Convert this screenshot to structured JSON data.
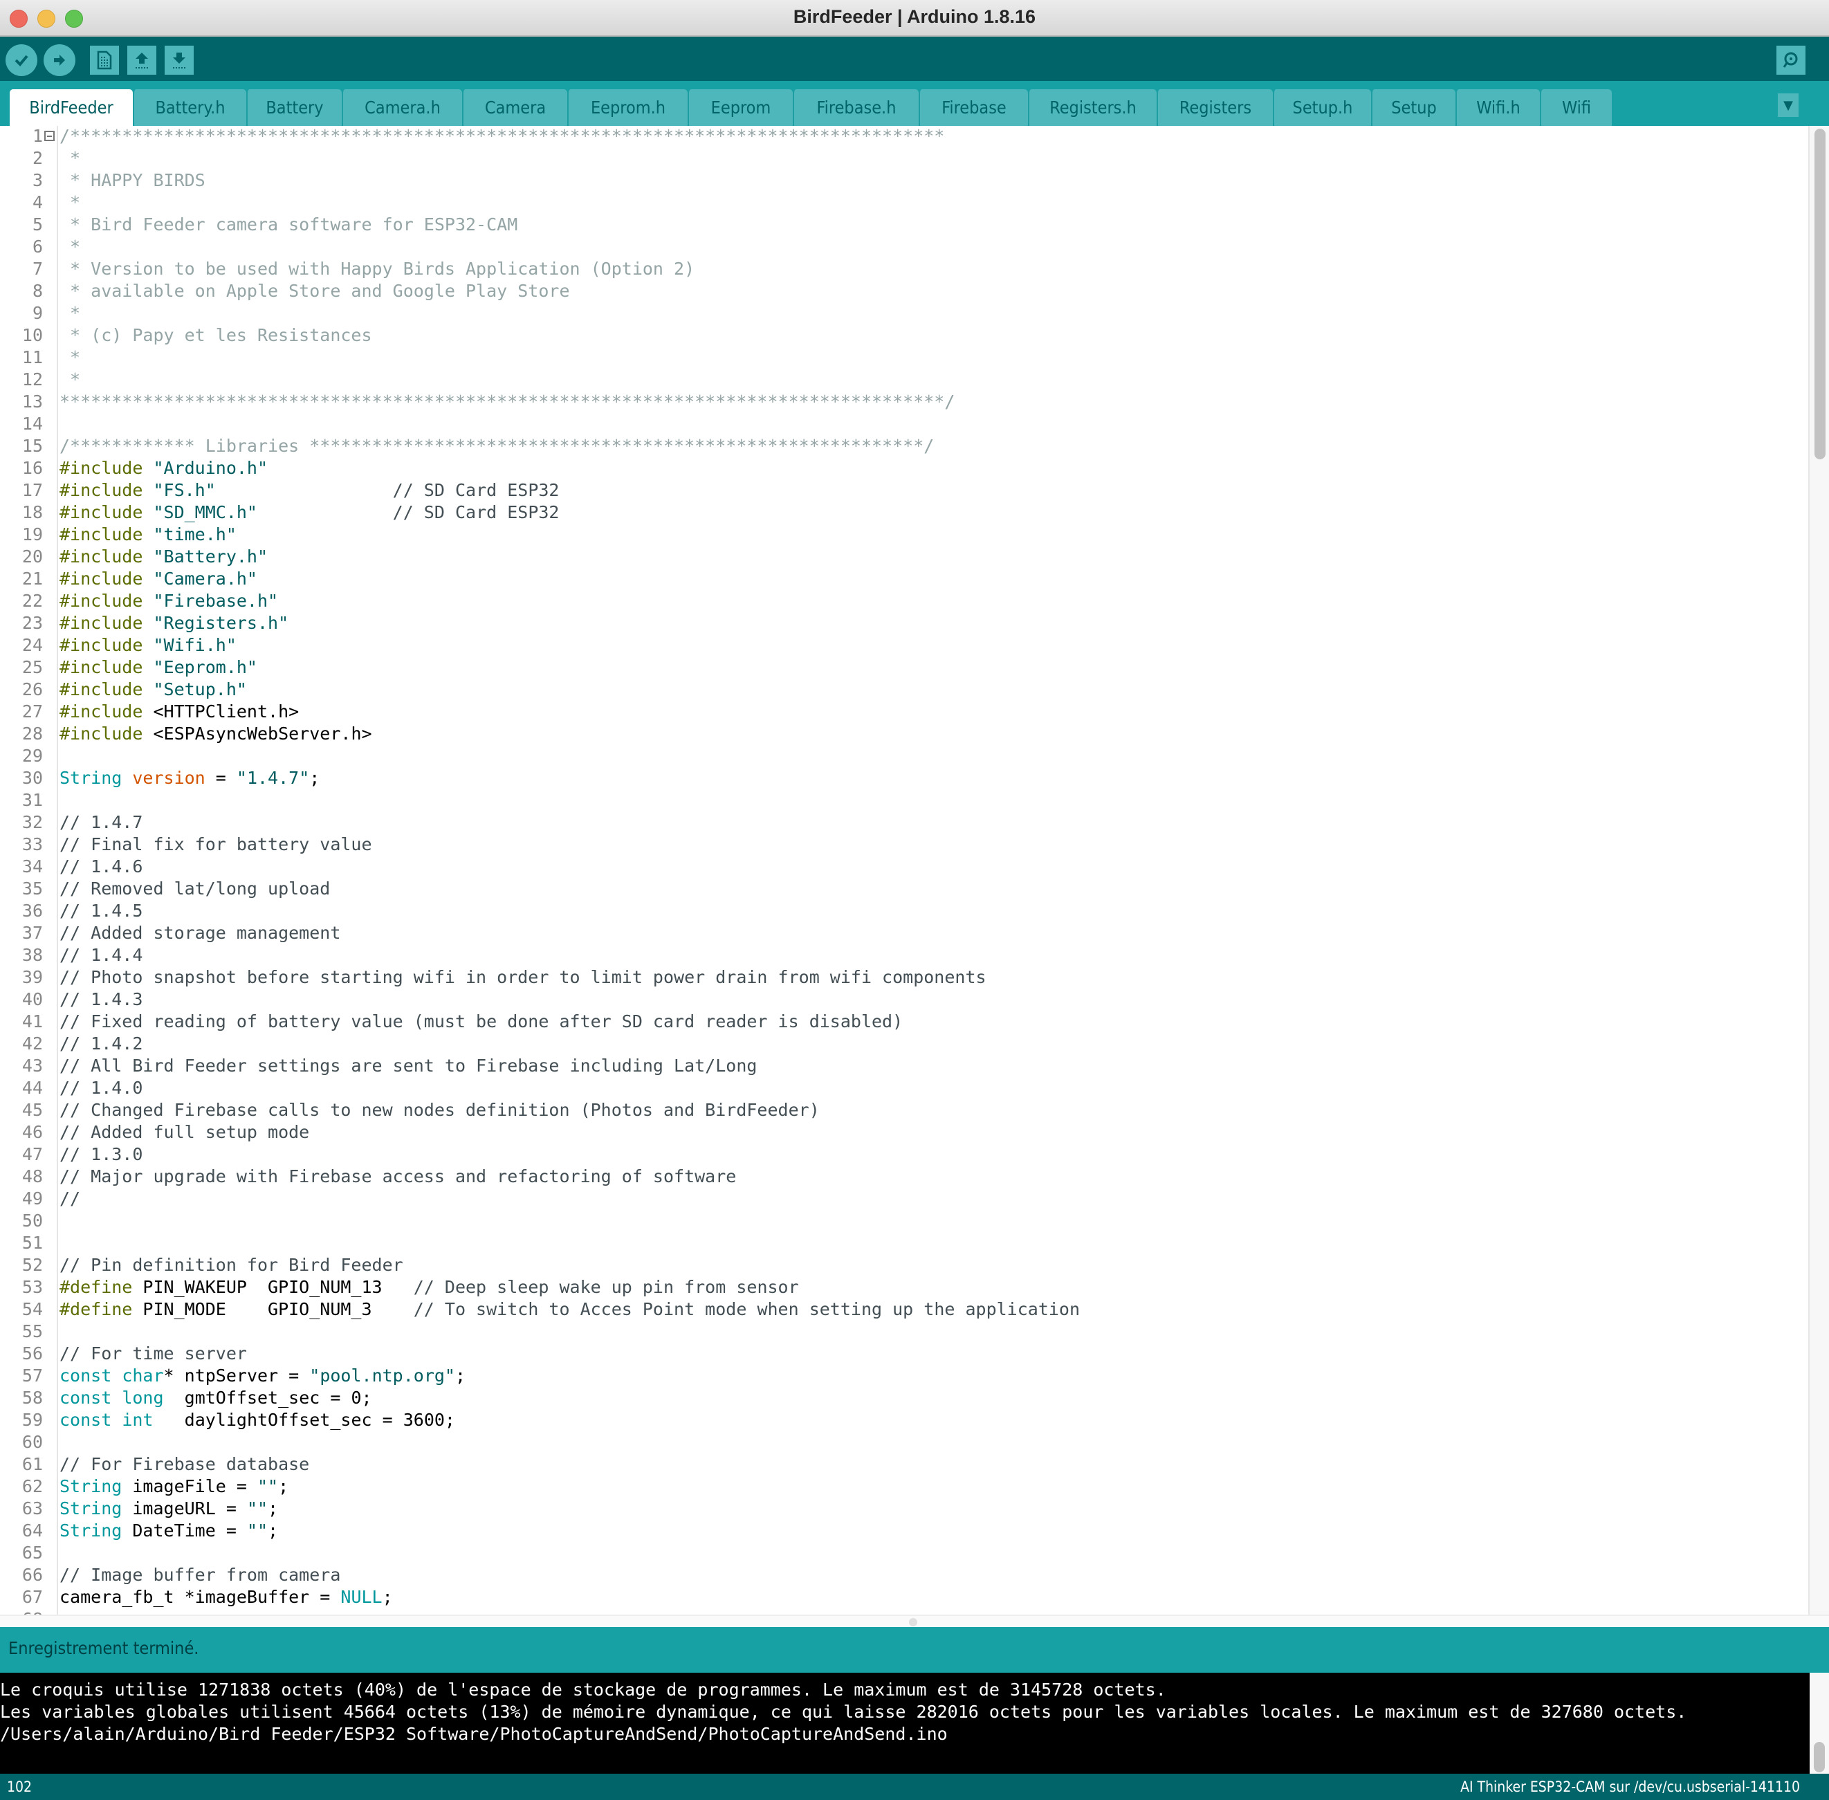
{
  "window": {
    "title": "BirdFeeder | Arduino 1.8.16"
  },
  "toolbar": {
    "verify_label": "Verify",
    "upload_label": "Upload",
    "new_label": "New",
    "open_label": "Open",
    "save_label": "Save",
    "serial_monitor_label": "Serial Monitor"
  },
  "tabs": [
    {
      "label": "BirdFeeder",
      "active": true
    },
    {
      "label": "Battery.h"
    },
    {
      "label": "Battery"
    },
    {
      "label": "Camera.h"
    },
    {
      "label": "Camera"
    },
    {
      "label": "Eeprom.h"
    },
    {
      "label": "Eeprom"
    },
    {
      "label": "Firebase.h"
    },
    {
      "label": "Firebase"
    },
    {
      "label": "Registers.h"
    },
    {
      "label": "Registers"
    },
    {
      "label": "Setup.h"
    },
    {
      "label": "Setup"
    },
    {
      "label": "Wifi.h"
    },
    {
      "label": "Wifi"
    }
  ],
  "colors": {
    "toolbar": "#006468",
    "tabbar": "#17a1a5",
    "tab_inactive": "#4db7bb",
    "comment_block": "#95a5a6",
    "comment_line": "#434f54",
    "preprocessor": "#5e6d03",
    "string": "#005c5f",
    "type": "#00979c",
    "variable": "#d35400"
  },
  "editor": {
    "lines": [
      [
        [
          "c-block",
          "/************************************************************************************"
        ]
      ],
      [
        [
          "c-block",
          " *"
        ]
      ],
      [
        [
          "c-block",
          " * HAPPY BIRDS"
        ]
      ],
      [
        [
          "c-block",
          " *"
        ]
      ],
      [
        [
          "c-block",
          " * Bird Feeder camera software for ESP32-CAM"
        ]
      ],
      [
        [
          "c-block",
          " *"
        ]
      ],
      [
        [
          "c-block",
          " * Version to be used with Happy Birds Application (Option 2)"
        ]
      ],
      [
        [
          "c-block",
          " * available on Apple Store and Google Play Store"
        ]
      ],
      [
        [
          "c-block",
          " *"
        ]
      ],
      [
        [
          "c-block",
          " * (c) Papy et les Resistances"
        ]
      ],
      [
        [
          "c-block",
          " *"
        ]
      ],
      [
        [
          "c-block",
          " *"
        ]
      ],
      [
        [
          "c-block",
          "*************************************************************************************/"
        ]
      ],
      [],
      [
        [
          "c-block",
          "/************ Libraries ***********************************************************/"
        ]
      ],
      [
        [
          "c-pp",
          "#include "
        ],
        [
          "c-str",
          "\"Arduino.h\""
        ]
      ],
      [
        [
          "c-pp",
          "#include "
        ],
        [
          "c-str",
          "\"FS.h\""
        ],
        [
          "c-plain",
          "                 "
        ],
        [
          "c-line",
          "// SD Card ESP32"
        ]
      ],
      [
        [
          "c-pp",
          "#include "
        ],
        [
          "c-str",
          "\"SD_MMC.h\""
        ],
        [
          "c-plain",
          "             "
        ],
        [
          "c-line",
          "// SD Card ESP32"
        ]
      ],
      [
        [
          "c-pp",
          "#include "
        ],
        [
          "c-str",
          "\"time.h\""
        ]
      ],
      [
        [
          "c-pp",
          "#include "
        ],
        [
          "c-str",
          "\"Battery.h\""
        ]
      ],
      [
        [
          "c-pp",
          "#include "
        ],
        [
          "c-str",
          "\"Camera.h\""
        ]
      ],
      [
        [
          "c-pp",
          "#include "
        ],
        [
          "c-str",
          "\"Firebase.h\""
        ]
      ],
      [
        [
          "c-pp",
          "#include "
        ],
        [
          "c-str",
          "\"Registers.h\""
        ]
      ],
      [
        [
          "c-pp",
          "#include "
        ],
        [
          "c-str",
          "\"Wifi.h\""
        ]
      ],
      [
        [
          "c-pp",
          "#include "
        ],
        [
          "c-str",
          "\"Eeprom.h\""
        ]
      ],
      [
        [
          "c-pp",
          "#include "
        ],
        [
          "c-str",
          "\"Setup.h\""
        ]
      ],
      [
        [
          "c-pp",
          "#include "
        ],
        [
          "c-plain",
          "<HTTPClient.h>"
        ]
      ],
      [
        [
          "c-pp",
          "#include "
        ],
        [
          "c-plain",
          "<ESPAsyncWebServer.h>"
        ]
      ],
      [],
      [
        [
          "c-type",
          "String"
        ],
        [
          "c-plain",
          " "
        ],
        [
          "c-var",
          "version"
        ],
        [
          "c-plain",
          " = "
        ],
        [
          "c-str",
          "\"1.4.7\""
        ],
        [
          "c-plain",
          ";"
        ]
      ],
      [],
      [
        [
          "c-line",
          "// 1.4.7"
        ]
      ],
      [
        [
          "c-line",
          "// Final fix for battery value"
        ]
      ],
      [
        [
          "c-line",
          "// 1.4.6"
        ]
      ],
      [
        [
          "c-line",
          "// Removed lat/long upload"
        ]
      ],
      [
        [
          "c-line",
          "// 1.4.5"
        ]
      ],
      [
        [
          "c-line",
          "// Added storage management"
        ]
      ],
      [
        [
          "c-line",
          "// 1.4.4"
        ]
      ],
      [
        [
          "c-line",
          "// Photo snapshot before starting wifi in order to limit power drain from wifi components"
        ]
      ],
      [
        [
          "c-line",
          "// 1.4.3"
        ]
      ],
      [
        [
          "c-line",
          "// Fixed reading of battery value (must be done after SD card reader is disabled)"
        ]
      ],
      [
        [
          "c-line",
          "// 1.4.2"
        ]
      ],
      [
        [
          "c-line",
          "// All Bird Feeder settings are sent to Firebase including Lat/Long"
        ]
      ],
      [
        [
          "c-line",
          "// 1.4.0"
        ]
      ],
      [
        [
          "c-line",
          "// Changed Firebase calls to new nodes definition (Photos and BirdFeeder)"
        ]
      ],
      [
        [
          "c-line",
          "// Added full setup mode"
        ]
      ],
      [
        [
          "c-line",
          "// 1.3.0"
        ]
      ],
      [
        [
          "c-line",
          "// Major upgrade with Firebase access and refactoring of software"
        ]
      ],
      [
        [
          "c-line",
          "//"
        ]
      ],
      [],
      [],
      [
        [
          "c-line",
          "// Pin definition for Bird Feeder"
        ]
      ],
      [
        [
          "c-pp",
          "#define"
        ],
        [
          "c-plain",
          " PIN_WAKEUP  GPIO_NUM_13   "
        ],
        [
          "c-line",
          "// Deep sleep wake up pin from sensor"
        ]
      ],
      [
        [
          "c-pp",
          "#define"
        ],
        [
          "c-plain",
          " PIN_MODE    GPIO_NUM_3    "
        ],
        [
          "c-line",
          "// To switch to Acces Point mode when setting up the application"
        ]
      ],
      [],
      [
        [
          "c-line",
          "// For time server"
        ]
      ],
      [
        [
          "c-type",
          "const"
        ],
        [
          "c-plain",
          " "
        ],
        [
          "c-type",
          "char"
        ],
        [
          "c-plain",
          "* ntpServer = "
        ],
        [
          "c-str",
          "\"pool.ntp.org\""
        ],
        [
          "c-plain",
          ";"
        ]
      ],
      [
        [
          "c-type",
          "const"
        ],
        [
          "c-plain",
          " "
        ],
        [
          "c-type",
          "long"
        ],
        [
          "c-plain",
          "  gmtOffset_sec = 0;"
        ]
      ],
      [
        [
          "c-type",
          "const"
        ],
        [
          "c-plain",
          " "
        ],
        [
          "c-type",
          "int"
        ],
        [
          "c-plain",
          "   daylightOffset_sec = 3600;"
        ]
      ],
      [],
      [
        [
          "c-line",
          "// For Firebase database"
        ]
      ],
      [
        [
          "c-type",
          "String"
        ],
        [
          "c-plain",
          " imageFile = "
        ],
        [
          "c-str",
          "\"\""
        ],
        [
          "c-plain",
          ";"
        ]
      ],
      [
        [
          "c-type",
          "String"
        ],
        [
          "c-plain",
          " imageURL = "
        ],
        [
          "c-str",
          "\"\""
        ],
        [
          "c-plain",
          ";"
        ]
      ],
      [
        [
          "c-type",
          "String"
        ],
        [
          "c-plain",
          " DateTime = "
        ],
        [
          "c-str",
          "\"\""
        ],
        [
          "c-plain",
          ";"
        ]
      ],
      [],
      [
        [
          "c-line",
          "// Image buffer from camera"
        ]
      ],
      [
        [
          "c-plain",
          "camera_fb_t *imageBuffer = "
        ],
        [
          "c-type",
          "NULL"
        ],
        [
          "c-plain",
          ";"
        ]
      ],
      []
    ]
  },
  "status": {
    "message": "Enregistrement terminé."
  },
  "console": {
    "lines": [
      "Le croquis utilise 1271838 octets (40%) de l'espace de stockage de programmes. Le maximum est de 3145728 octets.",
      "Les variables globales utilisent 45664 octets (13%) de mémoire dynamique, ce qui laisse 282016 octets pour les variables locales. Le maximum est de 327680 octets.",
      "/Users/alain/Arduino/Bird Feeder/ESP32 Software/PhotoCaptureAndSend/PhotoCaptureAndSend.ino"
    ]
  },
  "footer": {
    "line_number": "102",
    "board": "AI Thinker ESP32-CAM sur /dev/cu.usbserial-141110"
  }
}
